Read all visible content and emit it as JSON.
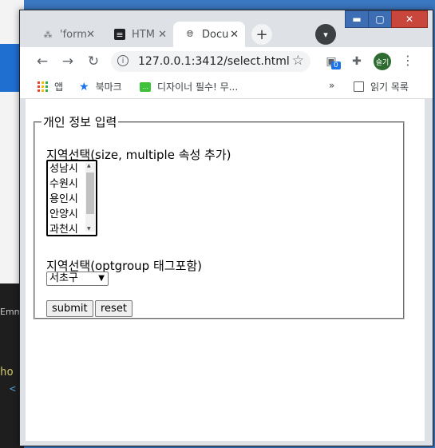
{
  "browser": {
    "tabs": [
      {
        "title": "'form",
        "favicon": "slack-like-icon"
      },
      {
        "title": "HTM",
        "favicon": "notion-icon"
      },
      {
        "title": "Docu",
        "favicon": "globe-icon",
        "active": true
      }
    ],
    "url": "127.0.0.1:3412/select.html",
    "extension_badge": "0",
    "profile_label": "슬기"
  },
  "bookmarks": [
    {
      "label": "앱",
      "icon": "apps-grid-icon"
    },
    {
      "label": "북마크",
      "icon": "star-icon"
    },
    {
      "label": "디자이너 필수! 무...",
      "icon": "chat-bubble-icon"
    }
  ],
  "bookmarks_overflow": "»",
  "reading_list_label": "읽기 목록",
  "form": {
    "legend": "개인 정보 입력",
    "label_size": "지역선택(size, multiple 속성 추가)",
    "listbox_options": [
      "성남시",
      "수원시",
      "용인시",
      "안양시",
      "과천시"
    ],
    "label_optgroup": "지역선택(optgroup 태그포함)",
    "select_value": "서초구",
    "submit_label": "submit",
    "reset_label": "reset"
  },
  "background": {
    "left_text": "Emm",
    "code_line_1": "ho",
    "code_line_2": "<"
  }
}
